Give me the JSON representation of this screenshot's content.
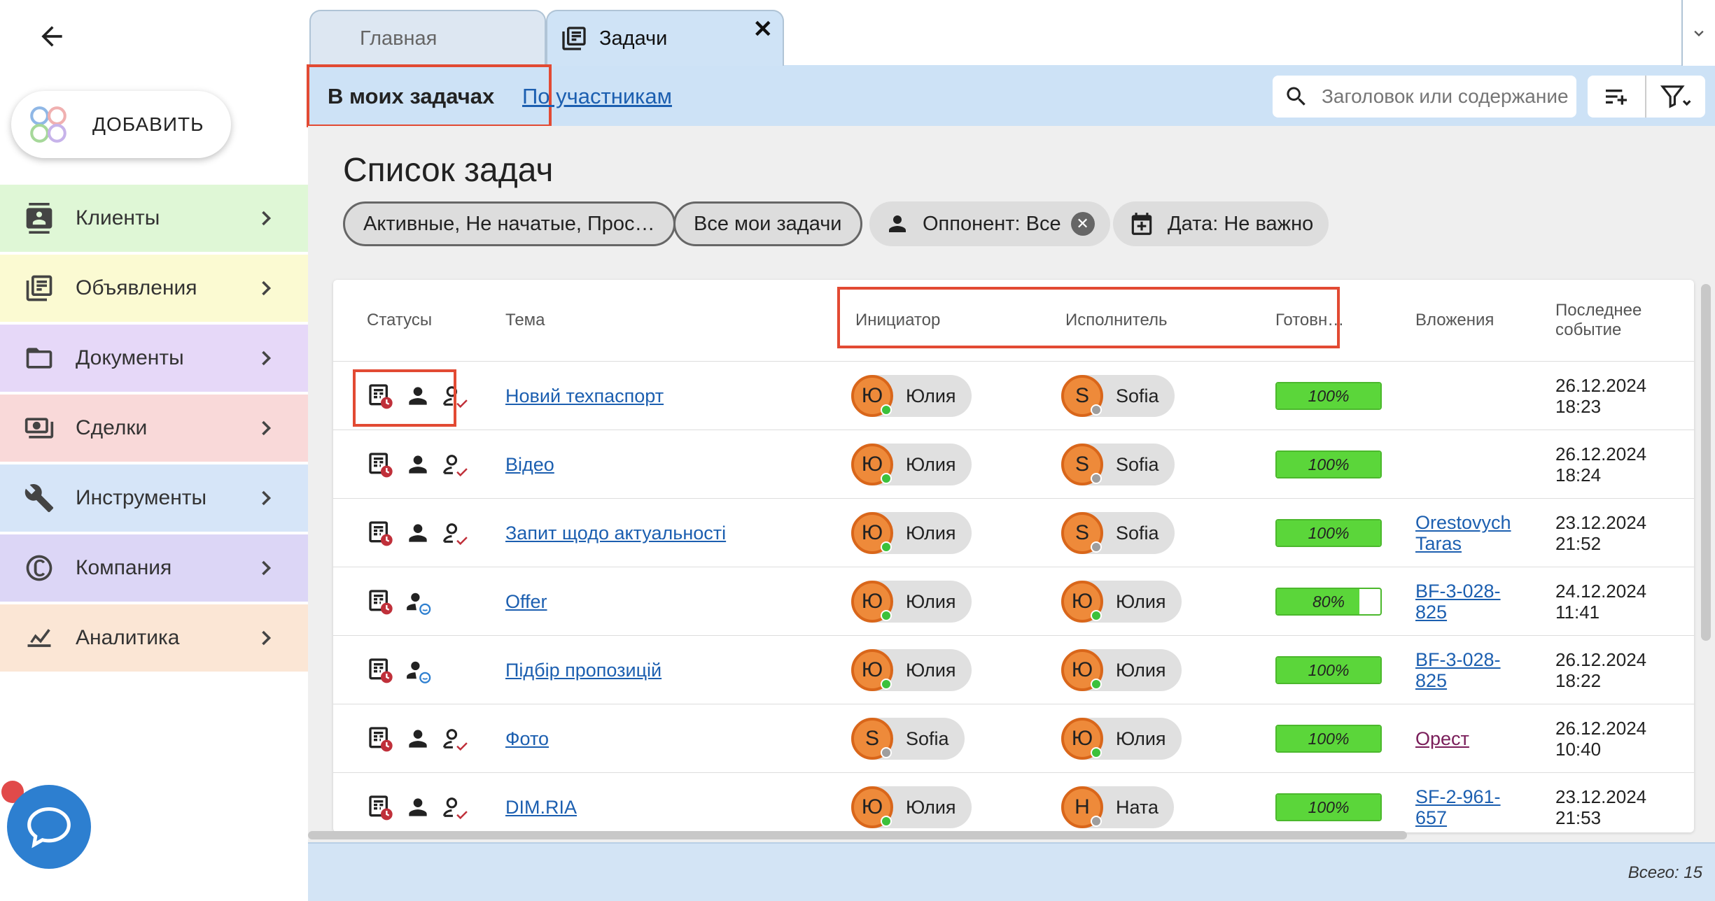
{
  "sidebar": {
    "add_label": "ДОБАВИТЬ",
    "items": [
      {
        "label": "Клиенты",
        "icon": "contacts-icon",
        "color": "#dff7d6"
      },
      {
        "label": "Объявления",
        "icon": "listing-icon",
        "color": "#fbfad2"
      },
      {
        "label": "Документы",
        "icon": "folder-icon",
        "color": "#e6d8f8"
      },
      {
        "label": "Сделки",
        "icon": "money-icon",
        "color": "#f9d9d9"
      },
      {
        "label": "Инструменты",
        "icon": "tools-icon",
        "color": "#d6e5f8"
      },
      {
        "label": "Компания",
        "icon": "copyright-icon",
        "color": "#dcd6f6"
      },
      {
        "label": "Аналитика",
        "icon": "analytics-icon",
        "color": "#fbe6d5"
      }
    ]
  },
  "tabs": [
    {
      "label": "Главная",
      "active": false
    },
    {
      "label": "Задачи",
      "active": true
    }
  ],
  "subnav": {
    "my_tasks": "В моих задачах",
    "by_participants": "По участникам"
  },
  "search": {
    "placeholder": "Заголовок или содержание"
  },
  "page_title": "Список задач",
  "filters": {
    "status": "Активные, Не начатые, Прос…",
    "scope": "Все мои задачи",
    "opponent": "Оппонент: Все",
    "date": "Дата: Не важно"
  },
  "table": {
    "headers": {
      "statuses": "Статусы",
      "topic": "Тема",
      "initiator": "Инициатор",
      "executor": "Исполнитель",
      "ready": "Готовн…",
      "attachments": "Вложения",
      "last_event_1": "Последнее",
      "last_event_2": "событие"
    },
    "rows": [
      {
        "topic": "Новий техпаспорт",
        "i_initial": "Ю",
        "i_name": "Юлия",
        "i_online": true,
        "e_initial": "S",
        "e_name": "Sofia",
        "e_online": false,
        "progress": 100,
        "progress_label": "100%",
        "att1": "",
        "att2": "",
        "att_color": "",
        "date": "26.12.2024",
        "time": "18:23",
        "icons": "full"
      },
      {
        "topic": "Відео",
        "i_initial": "Ю",
        "i_name": "Юлия",
        "i_online": true,
        "e_initial": "S",
        "e_name": "Sofia",
        "e_online": false,
        "progress": 100,
        "progress_label": "100%",
        "att1": "",
        "att2": "",
        "att_color": "",
        "date": "26.12.2024",
        "time": "18:24",
        "icons": "full"
      },
      {
        "topic": "Запит щодо актуальності",
        "i_initial": "Ю",
        "i_name": "Юлия",
        "i_online": true,
        "e_initial": "S",
        "e_name": "Sofia",
        "e_online": false,
        "progress": 100,
        "progress_label": "100%",
        "att1": "Orestovych",
        "att2": "Taras",
        "att_color": "blue",
        "date": "23.12.2024",
        "time": "21:52",
        "icons": "full"
      },
      {
        "topic": "Offer",
        "i_initial": "Ю",
        "i_name": "Юлия",
        "i_online": true,
        "e_initial": "Ю",
        "e_name": "Юлия",
        "e_online": true,
        "progress": 80,
        "progress_label": "80%",
        "att1": "BF-3-028-",
        "att2": "825",
        "att_color": "blue",
        "date": "24.12.2024",
        "time": "11:41",
        "icons": "self"
      },
      {
        "topic": "Підбір пропозицій",
        "i_initial": "Ю",
        "i_name": "Юлия",
        "i_online": true,
        "e_initial": "Ю",
        "e_name": "Юлия",
        "e_online": true,
        "progress": 100,
        "progress_label": "100%",
        "att1": "BF-3-028-",
        "att2": "825",
        "att_color": "blue",
        "date": "26.12.2024",
        "time": "18:22",
        "icons": "self"
      },
      {
        "topic": "Фото",
        "i_initial": "S",
        "i_name": "Sofia",
        "i_online": false,
        "e_initial": "Ю",
        "e_name": "Юлия",
        "e_online": true,
        "progress": 100,
        "progress_label": "100%",
        "att1": "Орест",
        "att2": "",
        "att_color": "purple",
        "date": "26.12.2024",
        "time": "10:40",
        "icons": "full"
      },
      {
        "topic": "DIM.RIA",
        "i_initial": "Ю",
        "i_name": "Юлия",
        "i_online": true,
        "e_initial": "Н",
        "e_name": "Ната",
        "e_online": false,
        "progress": 100,
        "progress_label": "100%",
        "att1": "SF-2-961-",
        "att2": "657",
        "att_color": "blue",
        "date": "23.12.2024",
        "time": "21:53",
        "icons": "full"
      }
    ]
  },
  "footer": {
    "total": "Всего: 15"
  },
  "colors": {
    "accent": "#1c5fb0",
    "highlight": "#e24a33",
    "online": "#3cc13b",
    "offline": "#9e9e9e",
    "avatar": "#ee8a3a",
    "progress": "#5bd63a"
  }
}
